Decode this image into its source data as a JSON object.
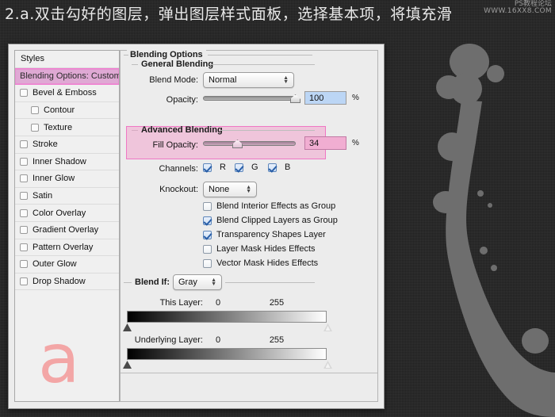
{
  "title": "2.a.双击勾好的图层，弹出图层样式面板，选择基本项，将填充滑",
  "watermark": {
    "line1": "PS教程论坛",
    "line2": "WWW.16XX8.COM"
  },
  "overlay_letter": "a",
  "colors": {
    "highlight_pink": "#ef77c4",
    "selection_purple": "#dfa9d4",
    "field_selection_blue": "#bcd6f5",
    "letter_pink": "#f4a0a0",
    "dialog_bg": "#ececec",
    "backdrop": "#232323",
    "splash_gray": "#6e6e6e"
  },
  "styles_panel": {
    "header": "Styles",
    "selected_item": "Blending Options: Custom",
    "items": [
      {
        "label": "Bevel & Emboss",
        "checked": false,
        "indent": false
      },
      {
        "label": "Contour",
        "checked": false,
        "indent": true
      },
      {
        "label": "Texture",
        "checked": false,
        "indent": true
      },
      {
        "label": "Stroke",
        "checked": false,
        "indent": false
      },
      {
        "label": "Inner Shadow",
        "checked": false,
        "indent": false
      },
      {
        "label": "Inner Glow",
        "checked": false,
        "indent": false
      },
      {
        "label": "Satin",
        "checked": false,
        "indent": false
      },
      {
        "label": "Color Overlay",
        "checked": false,
        "indent": false
      },
      {
        "label": "Gradient Overlay",
        "checked": false,
        "indent": false
      },
      {
        "label": "Pattern Overlay",
        "checked": false,
        "indent": false
      },
      {
        "label": "Outer Glow",
        "checked": false,
        "indent": false
      },
      {
        "label": "Drop Shadow",
        "checked": false,
        "indent": false
      }
    ]
  },
  "options": {
    "group_title": "Blending Options",
    "general": {
      "legend": "General Blending",
      "blend_mode_label": "Blend Mode:",
      "blend_mode_value": "Normal",
      "opacity_label": "Opacity:",
      "opacity_value": "100",
      "opacity_percent_sign": "%"
    },
    "advanced": {
      "legend": "Advanced Blending",
      "fill_opacity_label": "Fill Opacity:",
      "fill_opacity_value": "34",
      "fill_opacity_percent_sign": "%",
      "channels_label": "Channels:",
      "channels": [
        {
          "label": "R",
          "checked": true
        },
        {
          "label": "G",
          "checked": true
        },
        {
          "label": "B",
          "checked": true
        }
      ],
      "knockout_label": "Knockout:",
      "knockout_value": "None",
      "checkboxes": [
        {
          "label": "Blend Interior Effects as Group",
          "checked": false
        },
        {
          "label": "Blend Clipped Layers as Group",
          "checked": true
        },
        {
          "label": "Transparency Shapes Layer",
          "checked": true
        },
        {
          "label": "Layer Mask Hides Effects",
          "checked": false
        },
        {
          "label": "Vector Mask Hides Effects",
          "checked": false
        }
      ]
    },
    "blend_if": {
      "legend": "Blend If:",
      "channel_value": "Gray",
      "this_layer": {
        "label": "This Layer:",
        "min": "0",
        "max": "255"
      },
      "underlying_layer": {
        "label": "Underlying Layer:",
        "min": "0",
        "max": "255"
      }
    }
  }
}
